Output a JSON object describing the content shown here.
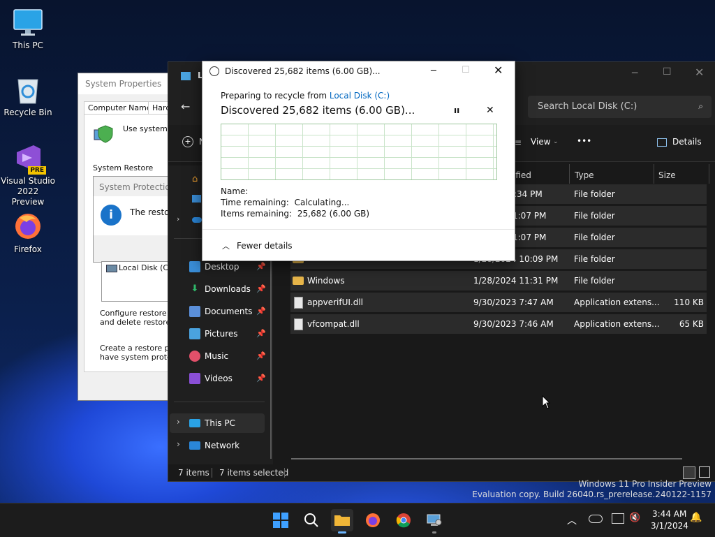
{
  "desktop": {
    "icons": [
      {
        "label": "This PC"
      },
      {
        "label": "Recycle Bin"
      },
      {
        "label": "Visual Studio 2022 Preview",
        "badge": "PRE"
      },
      {
        "label": "Firefox"
      }
    ],
    "watermark": {
      "line1": "Windows 11 Pro Insider Preview",
      "line2": "Evaluation copy. Build 26040.rs_prerelease.240122-1157"
    }
  },
  "system_properties": {
    "title": "System Properties",
    "tabs": [
      "Computer Name",
      "Hardw"
    ],
    "use_system_protection": "Use system pr",
    "system_restore_label": "System Restore",
    "system_protection_label": "System Protection",
    "restore_info": "The restor",
    "drive_item": "Local Disk (C:)",
    "configure_text_1": "Configure restore set",
    "configure_text_2": "and delete restore po",
    "create_text_1": "Create a restore poin",
    "create_text_2": "have system protecti"
  },
  "explorer": {
    "title_initial": "L",
    "search_placeholder": "Search Local Disk (C:)",
    "toolbar": {
      "new_initial": "N",
      "view_label": "View",
      "more_label": "•••",
      "details_label": "Details"
    },
    "columns": {
      "modified": "ified",
      "type": "Type",
      "size": "Size"
    },
    "nav": [
      {
        "label": "Desktop",
        "pinned": true
      },
      {
        "label": "Downloads",
        "pinned": true
      },
      {
        "label": "Documents",
        "pinned": true
      },
      {
        "label": "Pictures",
        "pinned": true
      },
      {
        "label": "Music",
        "pinned": true
      },
      {
        "label": "Videos",
        "pinned": true
      },
      {
        "label": "This PC"
      },
      {
        "label": "Network"
      }
    ],
    "rows": [
      {
        "name": "",
        "date": ":34 PM",
        "type": "File folder",
        "size": ""
      },
      {
        "name": "",
        "date": "1:07 PM",
        "type": "File folder",
        "size": ""
      },
      {
        "name": "",
        "date": "1:07 PM",
        "type": "File folder",
        "size": ""
      },
      {
        "name": "Users",
        "date": "1/28/2024 10:09 PM",
        "type": "File folder",
        "size": ""
      },
      {
        "name": "Windows",
        "date": "1/28/2024 11:31 PM",
        "type": "File folder",
        "size": ""
      },
      {
        "name": "appverifUI.dll",
        "date": "9/30/2023 7:47 AM",
        "type": "Application extens...",
        "size": "110 KB"
      },
      {
        "name": "vfcompat.dll",
        "date": "9/30/2023 7:46 AM",
        "type": "Application extens...",
        "size": "65 KB"
      }
    ],
    "status": {
      "count": "7 items",
      "selected": "7 items selected"
    }
  },
  "dialog": {
    "title": "Discovered 25,682 items (6.00 GB)...",
    "preparing_prefix": "Preparing to recycle from",
    "preparing_link": "Local Disk (C:)",
    "heading": "Discovered 25,682 items (6.00 GB)...",
    "name_label": "Name:",
    "time_label": "Time remaining:",
    "time_value": "Calculating...",
    "items_label": "Items remaining:",
    "items_value": "25,682 (6.00 GB)",
    "fewer_details": "Fewer details"
  },
  "taskbar": {
    "time": "3:44 AM",
    "date": "3/1/2024"
  },
  "colors": {
    "accent": "#0067c0",
    "explorer_bg": "#191919",
    "row_bg": "#2b2b2b"
  }
}
